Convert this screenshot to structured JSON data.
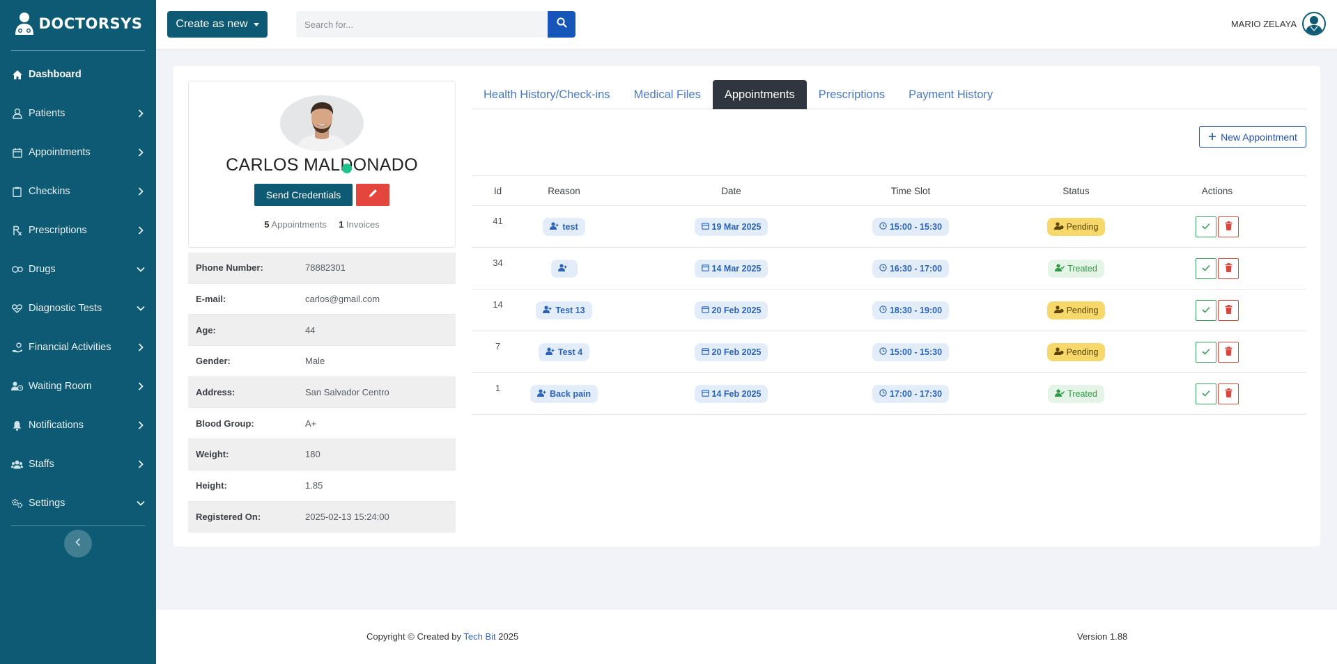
{
  "brand": {
    "name": "DOCTORSYS"
  },
  "sidebar": {
    "items": [
      {
        "label": "Dashboard",
        "icon": "home-icon",
        "active": true
      },
      {
        "label": "Patients",
        "icon": "user-icon",
        "chevron": "right"
      },
      {
        "label": "Appointments",
        "icon": "calendar-icon",
        "chevron": "right"
      },
      {
        "label": "Checkins",
        "icon": "clipboard-icon",
        "chevron": "right"
      },
      {
        "label": "Prescriptions",
        "icon": "prescription-icon",
        "chevron": "right"
      },
      {
        "label": "Drugs",
        "icon": "pills-icon",
        "chevron": "down"
      },
      {
        "label": "Diagnostic Tests",
        "icon": "heart-pulse-icon",
        "chevron": "down"
      },
      {
        "label": "Financial Activities",
        "icon": "hand-money-icon",
        "chevron": "right"
      },
      {
        "label": "Waiting Room",
        "icon": "users-clock-icon",
        "chevron": "right"
      },
      {
        "label": "Notifications",
        "icon": "bell-icon",
        "chevron": "right"
      },
      {
        "label": "Staffs",
        "icon": "users-icon",
        "chevron": "right"
      },
      {
        "label": "Settings",
        "icon": "gears-icon",
        "chevron": "down"
      }
    ]
  },
  "topbar": {
    "create_label": "Create as new",
    "search_placeholder": "Search for...",
    "user_name": "MARIO ZELAYA"
  },
  "profile": {
    "name": "CARLOS MALDONADO",
    "send_credentials_label": "Send Credentials",
    "appointments_count": "5",
    "appointments_label": "Appointments",
    "invoices_count": "1",
    "invoices_label": "Invoices",
    "info": [
      {
        "key": "Phone Number:",
        "value": "78882301"
      },
      {
        "key": "E-mail:",
        "value": "carlos@gmail.com"
      },
      {
        "key": "Age:",
        "value": "44"
      },
      {
        "key": "Gender:",
        "value": "Male"
      },
      {
        "key": "Address:",
        "value": "San Salvador Centro"
      },
      {
        "key": "Blood Group:",
        "value": "A+"
      },
      {
        "key": "Weight:",
        "value": "180"
      },
      {
        "key": "Height:",
        "value": "1.85"
      },
      {
        "key": "Registered On:",
        "value": "2025-02-13 15:24:00"
      }
    ]
  },
  "tabs": [
    {
      "label": "Health History/Check-ins"
    },
    {
      "label": "Medical Files"
    },
    {
      "label": "Appointments",
      "active": true
    },
    {
      "label": "Prescriptions"
    },
    {
      "label": "Payment History"
    }
  ],
  "new_appointment_label": "New Appointment",
  "appointments": {
    "headers": {
      "id": "Id",
      "reason": "Reason",
      "date": "Date",
      "slot": "Time Slot",
      "status": "Status",
      "actions": "Actions"
    },
    "rows": [
      {
        "id": "41",
        "reason": "test",
        "date": "19 Mar 2025",
        "slot": "15:00 - 15:30",
        "status": "Pending"
      },
      {
        "id": "34",
        "reason": "",
        "date": "14 Mar 2025",
        "slot": "16:30 - 17:00",
        "status": "Treated"
      },
      {
        "id": "14",
        "reason": "Test 13",
        "date": "20 Feb 2025",
        "slot": "18:30 - 19:00",
        "status": "Pending"
      },
      {
        "id": "7",
        "reason": "Test 4",
        "date": "20 Feb 2025",
        "slot": "15:00 - 15:30",
        "status": "Pending"
      },
      {
        "id": "1",
        "reason": "Back pain",
        "date": "14 Feb 2025",
        "slot": "17:00 - 17:30",
        "status": "Treated"
      }
    ]
  },
  "footer": {
    "copyright_prefix": "Copyright © Created by",
    "copyright_link": "Tech Bit",
    "copyright_year": "2025",
    "version": "Version 1.88"
  },
  "colors": {
    "sidebar": "#0c5a73",
    "primary_blue": "#1457b8",
    "delete_red": "#e5463b",
    "pending": "#f7d86b",
    "treated": "#e4f4e6"
  }
}
